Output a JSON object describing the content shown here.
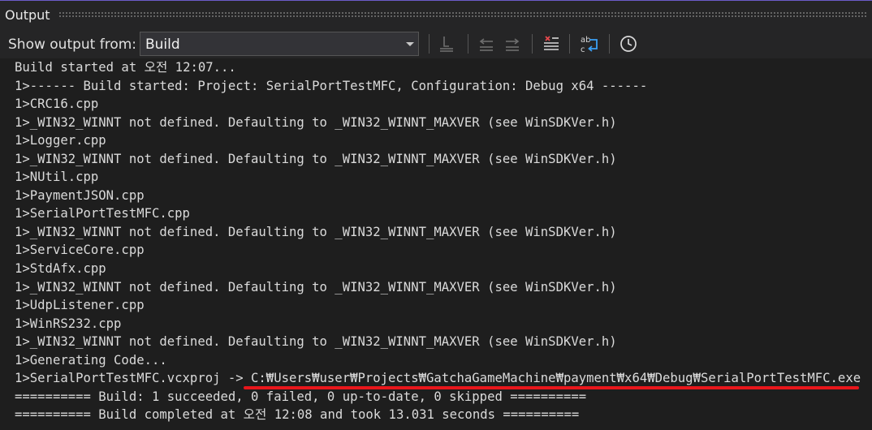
{
  "panel": {
    "title": "Output"
  },
  "toolbar": {
    "show_output_label": "Show output from:",
    "source_value": "Build",
    "icons": [
      "find-message-icon",
      "previous-message-icon",
      "next-message-icon",
      "clear-all-icon",
      "toggle-word-wrap-icon",
      "toggle-timestamp-icon"
    ]
  },
  "output": {
    "lines": [
      "Build started at 오전 12:07...",
      "1>------ Build started: Project: SerialPortTestMFC, Configuration: Debug x64 ------",
      "1>CRC16.cpp",
      "1>_WIN32_WINNT not defined. Defaulting to _WIN32_WINNT_MAXVER (see WinSDKVer.h)",
      "1>Logger.cpp",
      "1>_WIN32_WINNT not defined. Defaulting to _WIN32_WINNT_MAXVER (see WinSDKVer.h)",
      "1>NUtil.cpp",
      "1>PaymentJSON.cpp",
      "1>SerialPortTestMFC.cpp",
      "1>_WIN32_WINNT not defined. Defaulting to _WIN32_WINNT_MAXVER (see WinSDKVer.h)",
      "1>ServiceCore.cpp",
      "1>StdAfx.cpp",
      "1>_WIN32_WINNT not defined. Defaulting to _WIN32_WINNT_MAXVER (see WinSDKVer.h)",
      "1>UdpListener.cpp",
      "1>WinRS232.cpp",
      "1>_WIN32_WINNT not defined. Defaulting to _WIN32_WINNT_MAXVER (see WinSDKVer.h)",
      "1>Generating Code...",
      "1>SerialPortTestMFC.vcxproj -> C:₩Users₩user₩Projects₩GatchaGameMachine₩payment₩x64₩Debug₩SerialPortTestMFC.exe",
      "========== Build: 1 succeeded, 0 failed, 0 up-to-date, 0 skipped ==========",
      "========== Build completed at 오전 12:08 and took 13.031 seconds =========="
    ]
  },
  "colors": {
    "background": "#1e1e1e",
    "toolbar": "#252526",
    "highlight_underline": "#e8161b",
    "accent_border": "#6b5cc9"
  }
}
